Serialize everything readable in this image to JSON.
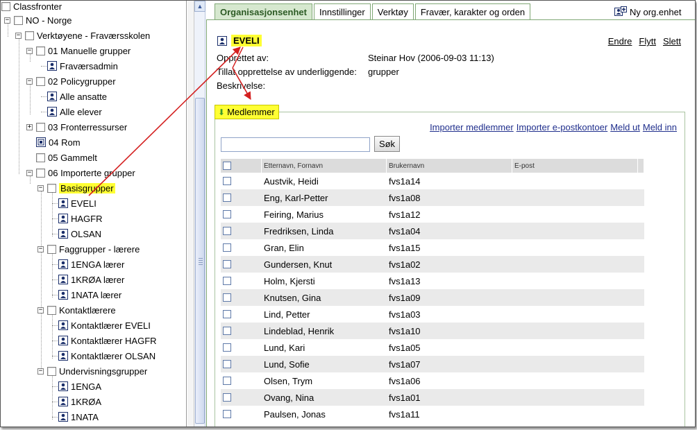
{
  "tree": {
    "nodes": [
      {
        "label": "Classfronter"
      },
      {
        "label": "NO - Norge"
      },
      {
        "label": "Verktøyene - Fraværsskolen"
      },
      {
        "label": "01 Manuelle grupper"
      },
      {
        "label": "Fraværsadmin"
      },
      {
        "label": "02 Policygrupper"
      },
      {
        "label": "Alle ansatte"
      },
      {
        "label": "Alle elever"
      },
      {
        "label": "03 Fronterressurser"
      },
      {
        "label": "04 Rom"
      },
      {
        "label": "05 Gammelt"
      },
      {
        "label": "06 Importerte grupper"
      },
      {
        "label": "Basisgrupper"
      },
      {
        "label": "EVELI"
      },
      {
        "label": "HAGFR"
      },
      {
        "label": "OLSAN"
      },
      {
        "label": "Faggrupper - lærere"
      },
      {
        "label": "1ENGA lærer"
      },
      {
        "label": "1KRØA lærer"
      },
      {
        "label": "1NATA lærer"
      },
      {
        "label": "Kontaktlærere"
      },
      {
        "label": "Kontaktlærer EVELI"
      },
      {
        "label": "Kontaktlærer HAGFR"
      },
      {
        "label": "Kontaktlærer OLSAN"
      },
      {
        "label": "Undervisningsgrupper"
      },
      {
        "label": "1ENGA"
      },
      {
        "label": "1KRØA"
      },
      {
        "label": "1NATA"
      }
    ]
  },
  "tabs": [
    {
      "label": "Organisasjonsenhet"
    },
    {
      "label": "Innstillinger"
    },
    {
      "label": "Verktøy"
    },
    {
      "label": "Fravær, karakter og orden"
    }
  ],
  "new_org_label": "Ny org.enhet",
  "unit": {
    "title": "EVELI",
    "actions": {
      "edit": "Endre",
      "move": "Flytt",
      "delete": "Slett"
    },
    "created_by_label": "Opprettet av:",
    "created_by_value": "Steinar Hov (2006-09-03 11:13)",
    "allow_label": "Tillat opprettelse av underliggende:",
    "allow_value": "grupper",
    "description_label": "Beskrivelse:"
  },
  "members": {
    "legend": "Medlemmer",
    "links": {
      "import_members": "Importer medlemmer",
      "import_email": "Importer e-postkontoer",
      "leave": "Meld ut",
      "join": "Meld inn"
    },
    "search_value": "",
    "search_button": "Søk",
    "columns": [
      "Etternavn, Fornavn",
      "Brukernavn",
      "E-post"
    ],
    "rows": [
      {
        "name": "Austvik, Heidi",
        "user": "fvs1a14",
        "email": ""
      },
      {
        "name": "Eng, Karl-Petter",
        "user": "fvs1a08",
        "email": ""
      },
      {
        "name": "Feiring, Marius",
        "user": "fvs1a12",
        "email": ""
      },
      {
        "name": "Fredriksen, Linda",
        "user": "fvs1a04",
        "email": ""
      },
      {
        "name": "Gran, Elin",
        "user": "fvs1a15",
        "email": ""
      },
      {
        "name": "Gundersen, Knut",
        "user": "fvs1a02",
        "email": ""
      },
      {
        "name": "Holm, Kjersti",
        "user": "fvs1a13",
        "email": ""
      },
      {
        "name": "Knutsen, Gina",
        "user": "fvs1a09",
        "email": ""
      },
      {
        "name": "Lind, Petter",
        "user": "fvs1a03",
        "email": ""
      },
      {
        "name": "Lindeblad, Henrik",
        "user": "fvs1a10",
        "email": ""
      },
      {
        "name": "Lund, Kari",
        "user": "fvs1a05",
        "email": ""
      },
      {
        "name": "Lund, Sofie",
        "user": "fvs1a07",
        "email": ""
      },
      {
        "name": "Olsen, Trym",
        "user": "fvs1a06",
        "email": ""
      },
      {
        "name": "Ovang, Nina",
        "user": "fvs1a01",
        "email": ""
      },
      {
        "name": "Paulsen, Jonas",
        "user": "fvs1a11",
        "email": ""
      }
    ]
  },
  "colors": {
    "highlight": "#ffff33",
    "tab_active_bg": "#d6e8cf",
    "tab_border": "#7fa774",
    "link": "#1f2e8c",
    "annotation_arrow": "#d42020"
  }
}
